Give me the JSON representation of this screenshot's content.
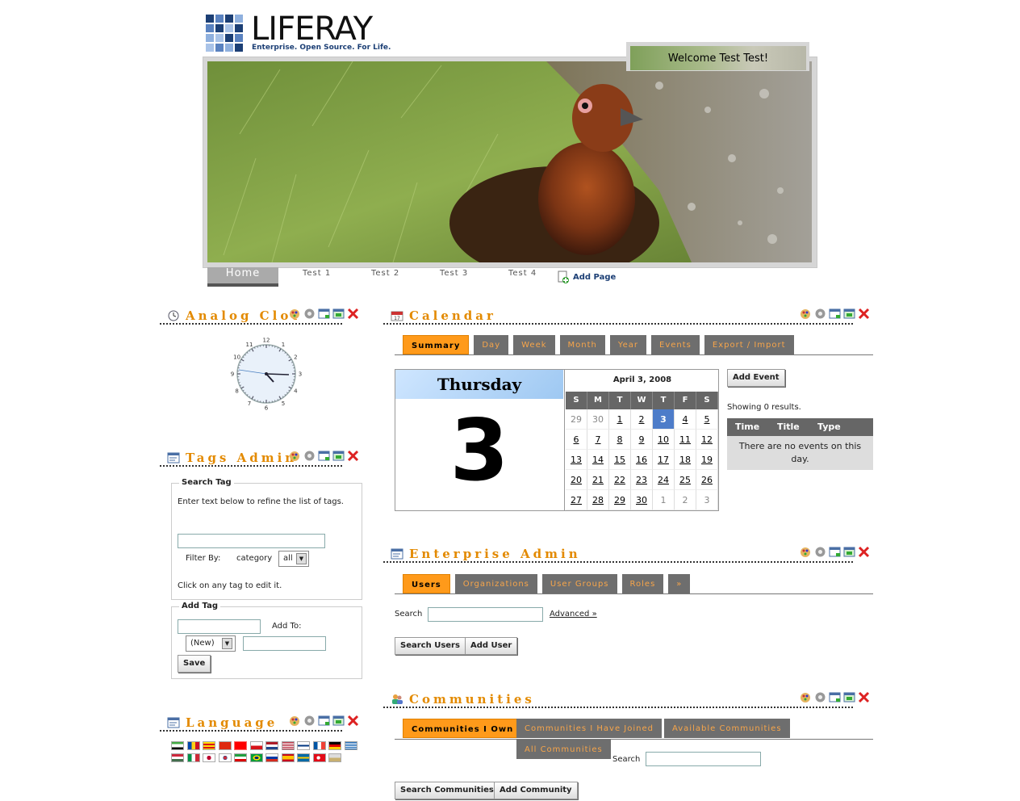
{
  "header": {
    "logo_word": "LIFERAY",
    "logo_tagline": "Enterprise. Open Source. For Life.",
    "welcome": "Welcome Test Test!"
  },
  "nav": {
    "items": [
      "Home",
      "Test 1",
      "Test 2",
      "Test 3",
      "Test 4"
    ],
    "add_page": "Add Page"
  },
  "analog_clock": {
    "title": "Analog Clock",
    "hours": [
      "12",
      "1",
      "2",
      "3",
      "4",
      "5",
      "6",
      "7",
      "8",
      "9",
      "10",
      "11"
    ]
  },
  "tags_admin": {
    "title": "Tags Admin",
    "search_legend": "Search Tag",
    "search_help": "Enter text below to refine the list of tags.",
    "filter_by": "Filter By:",
    "filter_category": "category",
    "filter_value": "all",
    "click_help": "Click on any tag to edit it.",
    "add_legend": "Add Tag",
    "add_to": "Add To:",
    "new_option": "(New)",
    "save": "Save"
  },
  "language": {
    "title": "Language"
  },
  "calendar": {
    "title": "Calendar",
    "tabs": [
      "Summary",
      "Day",
      "Week",
      "Month",
      "Year",
      "Events",
      "Export / Import"
    ],
    "weekday": "Thursday",
    "day_number": "3",
    "month_label": "April 3, 2008",
    "dow": [
      "S",
      "M",
      "T",
      "W",
      "T",
      "F",
      "S"
    ],
    "days": [
      "29",
      "30",
      "1",
      "2",
      "3",
      "4",
      "5",
      "6",
      "7",
      "8",
      "9",
      "10",
      "11",
      "12",
      "13",
      "14",
      "15",
      "16",
      "17",
      "18",
      "19",
      "20",
      "21",
      "22",
      "23",
      "24",
      "25",
      "26",
      "27",
      "28",
      "29",
      "30",
      "1",
      "2",
      "3"
    ],
    "add_event": "Add Event",
    "showing": "Showing 0 results.",
    "event_headers": [
      "Time",
      "Title",
      "Type"
    ],
    "no_events": "There are no events on this day."
  },
  "enterprise_admin": {
    "title": "Enterprise Admin",
    "tabs": [
      "Users",
      "Organizations",
      "User Groups",
      "Roles",
      "»"
    ],
    "search_label": "Search",
    "advanced": "Advanced »",
    "search_users": "Search Users",
    "add_user": "Add User"
  },
  "communities": {
    "title": "Communities",
    "tabs": [
      "Communities I Own",
      "Communities I Have Joined",
      "Available Communities",
      "All Communities"
    ],
    "search_label": "Search",
    "search_button": "Search Communities",
    "add_button": "Add Community"
  },
  "colors": {
    "accent": "#e38a00",
    "tab_active": "#ff9a1a",
    "tab_inactive": "#6e6e6e",
    "today": "#4d7cc9"
  }
}
